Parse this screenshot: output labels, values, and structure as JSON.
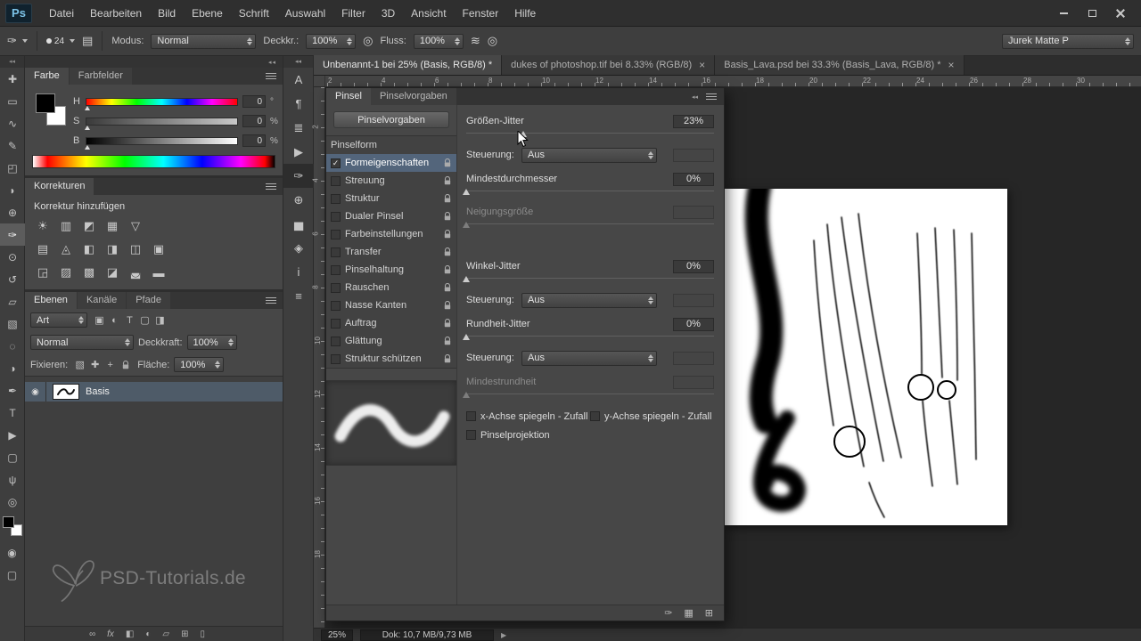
{
  "menubar": {
    "logo": "Ps",
    "items": [
      "Datei",
      "Bearbeiten",
      "Bild",
      "Ebene",
      "Schrift",
      "Auswahl",
      "Filter",
      "3D",
      "Ansicht",
      "Fenster",
      "Hilfe"
    ]
  },
  "options_bar": {
    "tool_icon": "✑",
    "panel_toggle_icon": "▤",
    "brush_size": "24",
    "modus_label": "Modus:",
    "modus_value": "Normal",
    "deckkraft_label": "Deckkr.:",
    "deckkraft_value": "100%",
    "tablet_opacity_icon": "◎",
    "fluss_label": "Fluss:",
    "fluss_value": "100%",
    "airbrush_icon": "≋",
    "tablet_size_icon": "◎",
    "workspace": "Jurek Matte P"
  },
  "toolbar": {
    "tools": [
      {
        "name": "move-tool",
        "glyph": "✚"
      },
      {
        "name": "marquee-tool",
        "glyph": "▭"
      },
      {
        "name": "lasso-tool",
        "glyph": "∿"
      },
      {
        "name": "quick-selection-tool",
        "glyph": "✎"
      },
      {
        "name": "crop-tool",
        "glyph": "◰"
      },
      {
        "name": "eyedropper-tool",
        "glyph": "◗"
      },
      {
        "name": "healing-brush-tool",
        "glyph": "⊕"
      },
      {
        "name": "brush-tool",
        "glyph": "✑",
        "active": true
      },
      {
        "name": "clone-stamp-tool",
        "glyph": "⊙"
      },
      {
        "name": "history-brush-tool",
        "glyph": "↺"
      },
      {
        "name": "eraser-tool",
        "glyph": "▱"
      },
      {
        "name": "gradient-tool",
        "glyph": "▧"
      },
      {
        "name": "blur-tool",
        "glyph": "◌"
      },
      {
        "name": "dodge-tool",
        "glyph": "◑"
      },
      {
        "name": "pen-tool",
        "glyph": "✒"
      },
      {
        "name": "type-tool",
        "glyph": "T"
      },
      {
        "name": "path-selection-tool",
        "glyph": "▶"
      },
      {
        "name": "shape-tool",
        "glyph": "▢"
      },
      {
        "name": "hand-tool",
        "glyph": "ψ"
      },
      {
        "name": "zoom-tool",
        "glyph": "◎"
      }
    ],
    "bottom": [
      {
        "name": "quick-mask-button",
        "glyph": "◉"
      },
      {
        "name": "screen-mode-button",
        "glyph": "▢"
      }
    ]
  },
  "color_panel": {
    "tabs": [
      "Farbe",
      "Farbfelder"
    ],
    "sliders": [
      {
        "label": "H",
        "value": "0",
        "unit": "°"
      },
      {
        "label": "S",
        "value": "0",
        "unit": "%"
      },
      {
        "label": "B",
        "value": "0",
        "unit": "%"
      }
    ]
  },
  "adjustments_panel": {
    "title": "Korrekturen",
    "subtitle": "Korrektur hinzufügen",
    "rows": [
      [
        {
          "name": "brightness-contrast-icon",
          "glyph": "☀"
        },
        {
          "name": "levels-icon",
          "glyph": "▥"
        },
        {
          "name": "curves-icon",
          "glyph": "◩"
        },
        {
          "name": "exposure-icon",
          "glyph": "▦"
        },
        {
          "name": "vibrance-icon",
          "glyph": "▽"
        }
      ],
      [
        {
          "name": "hue-saturation-icon",
          "glyph": "▤"
        },
        {
          "name": "color-balance-icon",
          "glyph": "◬"
        },
        {
          "name": "black-white-icon",
          "glyph": "◧"
        },
        {
          "name": "photo-filter-icon",
          "glyph": "◨"
        },
        {
          "name": "channel-mixer-icon",
          "glyph": "◫"
        },
        {
          "name": "color-lookup-icon",
          "glyph": "▣"
        }
      ],
      [
        {
          "name": "invert-icon",
          "glyph": "◲"
        },
        {
          "name": "posterize-icon",
          "glyph": "▨"
        },
        {
          "name": "threshold-icon",
          "glyph": "▩"
        },
        {
          "name": "gradient-map-icon",
          "glyph": "◪"
        },
        {
          "name": "selective-color-icon",
          "glyph": "◛"
        },
        {
          "name": "pattern-icon",
          "glyph": "▬"
        }
      ]
    ]
  },
  "layers_panel": {
    "tabs": [
      "Ebenen",
      "Kanäle",
      "Pfade"
    ],
    "filter_label": "Art",
    "filter_icons": [
      {
        "name": "filter-pixel-layers-icon",
        "glyph": "▣"
      },
      {
        "name": "filter-adjustment-layers-icon",
        "glyph": "◐"
      },
      {
        "name": "filter-type-layers-icon",
        "glyph": "T"
      },
      {
        "name": "filter-shape-layers-icon",
        "glyph": "▢"
      },
      {
        "name": "filter-smart-objects-icon",
        "glyph": "◨"
      }
    ],
    "blend_mode": "Normal",
    "opacity_label": "Deckkraft:",
    "opacity_value": "100%",
    "lock_label": "Fixieren:",
    "lock_icons": [
      {
        "name": "lock-transparency-icon",
        "glyph": "▧"
      },
      {
        "name": "lock-pixels-icon",
        "glyph": "✚"
      },
      {
        "name": "lock-position-icon",
        "glyph": "+"
      },
      {
        "name": "lock-all-icon",
        "glyph": "LOCK"
      }
    ],
    "fill_label": "Fläche:",
    "fill_value": "100%",
    "layer": {
      "name": "Basis"
    },
    "bottom_icons": [
      {
        "name": "link-layers-icon",
        "glyph": "∞"
      },
      {
        "name": "layer-style-icon",
        "glyph": "fx"
      },
      {
        "name": "layer-mask-icon",
        "glyph": "◧"
      },
      {
        "name": "adjustment-layer-icon",
        "glyph": "◐"
      },
      {
        "name": "layer-group-icon",
        "glyph": "▱"
      },
      {
        "name": "new-layer-icon",
        "glyph": "⊞"
      },
      {
        "name": "delete-layer-icon",
        "glyph": "▯"
      }
    ]
  },
  "panel_strip": {
    "icons": [
      {
        "name": "character-panel-icon",
        "glyph": "A"
      },
      {
        "name": "paragraph-panel-icon",
        "glyph": "¶"
      },
      {
        "name": "character-styles-panel-icon",
        "glyph": "≣"
      },
      {
        "name": "actions-panel-icon",
        "glyph": "▶"
      },
      {
        "name": "brush-panel-icon",
        "glyph": "✑",
        "active": true
      },
      {
        "name": "clone-source-panel-icon",
        "glyph": "⊕"
      },
      {
        "name": "histogram-panel-icon",
        "glyph": "▅"
      },
      {
        "name": "navigator-panel-icon",
        "glyph": "◈"
      },
      {
        "name": "info-panel-icon",
        "glyph": "i"
      },
      {
        "name": "properties-panel-icon",
        "glyph": "≡"
      }
    ]
  },
  "document": {
    "tabs": [
      {
        "label": "Unbenannt-1 bei 25% (Basis, RGB/8) *",
        "active": true,
        "closable": false
      },
      {
        "label": "dukes of photoshop.tif bei 8.33% (RGB/8)",
        "active": false,
        "closable": true
      },
      {
        "label": "Basis_Lava.psd bei 33.3% (Basis_Lava, RGB/8) *",
        "active": false,
        "closable": true
      }
    ],
    "ruler_h": [
      2,
      4,
      6,
      8,
      10,
      12,
      14,
      16,
      18,
      20,
      22,
      24,
      26,
      28,
      30
    ],
    "ruler_v": [
      2,
      4,
      6,
      8,
      10,
      12,
      14,
      16,
      18
    ]
  },
  "brush_panel": {
    "tabs": [
      {
        "label": "Pinsel",
        "active": true
      },
      {
        "label": "Pinselvorgaben",
        "active": false
      }
    ],
    "presets_button": "Pinselvorgaben",
    "list": [
      {
        "label": "Pinselform",
        "checkbox": false,
        "checked": false,
        "selected": false,
        "lock": false
      },
      {
        "label": "Formeigenschaften",
        "checkbox": true,
        "checked": true,
        "selected": true,
        "lock": true
      },
      {
        "label": "Streuung",
        "checkbox": true,
        "checked": false,
        "selected": false,
        "lock": true
      },
      {
        "label": "Struktur",
        "checkbox": true,
        "checked": false,
        "selected": false,
        "lock": true
      },
      {
        "label": "Dualer Pinsel",
        "checkbox": true,
        "checked": false,
        "selected": false,
        "lock": true
      },
      {
        "label": "Farbeinstellungen",
        "checkbox": true,
        "checked": false,
        "selected": false,
        "lock": true
      },
      {
        "label": "Transfer",
        "checkbox": true,
        "checked": false,
        "selected": false,
        "lock": true
      },
      {
        "label": "Pinselhaltung",
        "checkbox": true,
        "checked": false,
        "selected": false,
        "lock": true
      },
      {
        "label": "Rauschen",
        "checkbox": true,
        "checked": false,
        "selected": false,
        "lock": true
      },
      {
        "label": "Nasse Kanten",
        "checkbox": true,
        "checked": false,
        "selected": false,
        "lock": true
      },
      {
        "label": "Auftrag",
        "checkbox": true,
        "checked": false,
        "selected": false,
        "lock": true
      },
      {
        "label": "Glättung",
        "checkbox": true,
        "checked": false,
        "selected": false,
        "lock": true
      },
      {
        "label": "Struktur schützen",
        "checkbox": true,
        "checked": false,
        "selected": false,
        "lock": true
      }
    ],
    "controls": [
      {
        "type": "param",
        "label": "Größen-Jitter",
        "value": "23%",
        "slider": 23,
        "enabled": true
      },
      {
        "type": "steuerung",
        "label": "Steuerung:",
        "value": "Aus"
      },
      {
        "type": "param",
        "label": "Mindestdurchmesser",
        "value": "0%",
        "slider": 0,
        "enabled": true
      },
      {
        "type": "param",
        "label": "Neigungsgröße",
        "value": "",
        "slider": 0,
        "enabled": false
      },
      {
        "type": "gap"
      },
      {
        "type": "param",
        "label": "Winkel-Jitter",
        "value": "0%",
        "slider": 0,
        "enabled": true
      },
      {
        "type": "steuerung",
        "label": "Steuerung:",
        "value": "Aus"
      },
      {
        "type": "param",
        "label": "Rundheit-Jitter",
        "value": "0%",
        "slider": 0,
        "enabled": true
      },
      {
        "type": "steuerung",
        "label": "Steuerung:",
        "value": "Aus"
      },
      {
        "type": "param",
        "label": "Mindestrundheit",
        "value": "",
        "slider": 0,
        "enabled": false
      }
    ],
    "checkbox_rows": [
      [
        "x-Achse spiegeln - Zufall",
        "y-Achse spiegeln - Zufall"
      ],
      [
        "Pinselprojektion"
      ]
    ],
    "footer_icons": [
      {
        "name": "brush-stroke-preview-icon",
        "glyph": "✑"
      },
      {
        "name": "texture-icon",
        "glyph": "▦"
      },
      {
        "name": "new-brush-icon",
        "glyph": "⊞"
      }
    ]
  },
  "status_bar": {
    "zoom": "25%",
    "doc_info": "Dok: 10,7 MB/9,73 MB",
    "expand_icon": "▶"
  },
  "watermark": {
    "text": "PSD-Tutorials.de"
  },
  "icons": {
    "close_tab": "×",
    "collapse": "◂◂",
    "eye": "◉",
    "check": "✓"
  }
}
